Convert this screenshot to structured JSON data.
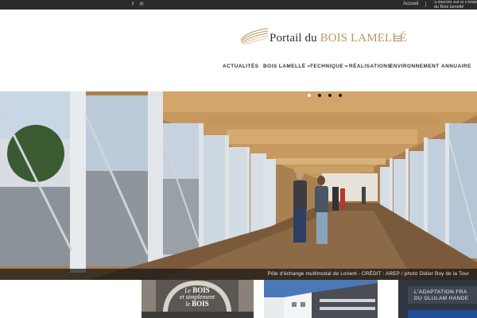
{
  "topbar": {
    "social": [
      {
        "icon": "facebook-icon",
        "glyph": "f"
      },
      {
        "icon": "pinterest-icon",
        "glyph": "℗"
      }
    ],
    "links": {
      "accueil": "Accueil",
      "inscrire": "S'inscrire sur le Portail du Bois lamellé"
    }
  },
  "logo": {
    "text_main": "Portail du ",
    "text_accent": "BOIS LAMELLÉ"
  },
  "nav": {
    "items": [
      {
        "label": "ACTUALITÉS",
        "dropdown": false
      },
      {
        "label": "BOIS LAMELLÉ",
        "dropdown": true
      },
      {
        "label": "TECHNIQUE",
        "dropdown": true
      },
      {
        "label": "RÉALISATIONS",
        "dropdown": false
      },
      {
        "label": "ENVIRONNEMENT",
        "dropdown": false
      },
      {
        "label": "ANNUAIRE",
        "dropdown": false
      }
    ]
  },
  "slider": {
    "caption": "Pôle d'échange multimodal de Lorient - CRÉDIT : AREP / photo Didier Boy de la Tour",
    "slide_count": 4,
    "active_slide": 1
  },
  "tiles": [
    {
      "line1": "Le",
      "line2": "BOIS",
      "line3": "et simplement",
      "line4": "le",
      "line5": "BOIS"
    },
    {},
    {
      "line1": "L'ADAPTATION FRA",
      "line2": "DU GLULAM HANDE"
    }
  ],
  "colors": {
    "topbar_bg": "#2b2b2b",
    "accent": "#b89762",
    "nav_text": "#333333",
    "caption_bg": "#141414"
  }
}
